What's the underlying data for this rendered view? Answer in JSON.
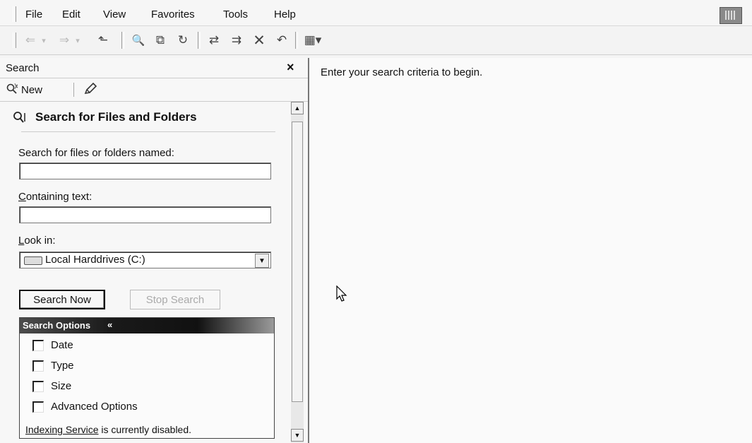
{
  "menu": {
    "items": [
      {
        "label": "File"
      },
      {
        "label": "Edit"
      },
      {
        "label": "View"
      },
      {
        "label": "Favorites"
      },
      {
        "label": "Tools"
      },
      {
        "label": "Help"
      }
    ]
  },
  "toolbar": {
    "buttons": [
      {
        "icon": "back-arrow-icon",
        "glyph": "⇐"
      },
      {
        "icon": "dropdown-arrow-icon",
        "glyph": "▾"
      },
      {
        "icon": "forward-arrow-icon",
        "glyph": "⇒"
      },
      {
        "icon": "dropdown-arrow-icon",
        "glyph": "▾"
      },
      {
        "icon": "up-folder-icon",
        "glyph": "⬑"
      },
      {
        "icon": "search-icon",
        "glyph": "🔍"
      },
      {
        "icon": "folders-icon",
        "glyph": "⧉"
      },
      {
        "icon": "history-icon",
        "glyph": "↻"
      },
      {
        "icon": "move-to-icon",
        "glyph": "⇄"
      },
      {
        "icon": "copy-to-icon",
        "glyph": "⇉"
      },
      {
        "icon": "delete-icon",
        "glyph": "✕"
      },
      {
        "icon": "undo-icon",
        "glyph": "↶"
      },
      {
        "icon": "views-icon",
        "glyph": "▦▾"
      }
    ]
  },
  "search_pane": {
    "title": "Search",
    "close_glyph": "×",
    "new_label": "New",
    "section_title": "Search for Files and Folders",
    "files_label": "Search for files or folders named:",
    "files_value": "",
    "containing_label": "ontaining text:",
    "containing_mnemonic": "C",
    "containing_value": "",
    "look_in_label": "ook in:",
    "look_in_mnemonic": "L",
    "look_in_value": "Local Harddrives (C:)",
    "search_now": "Search Now",
    "stop_search": "Stop Search",
    "options": {
      "title": "Search Options",
      "collapse_glyph": "«",
      "items": [
        {
          "label": "Date",
          "checked": false
        },
        {
          "label": "Type",
          "checked": false
        },
        {
          "label": "Size",
          "checked": false
        },
        {
          "label": "Advanced Options",
          "checked": false
        }
      ],
      "index_link": "Indexing Service",
      "index_rest": " is currently disabled."
    }
  },
  "results": {
    "message": "Enter your search criteria to begin."
  }
}
